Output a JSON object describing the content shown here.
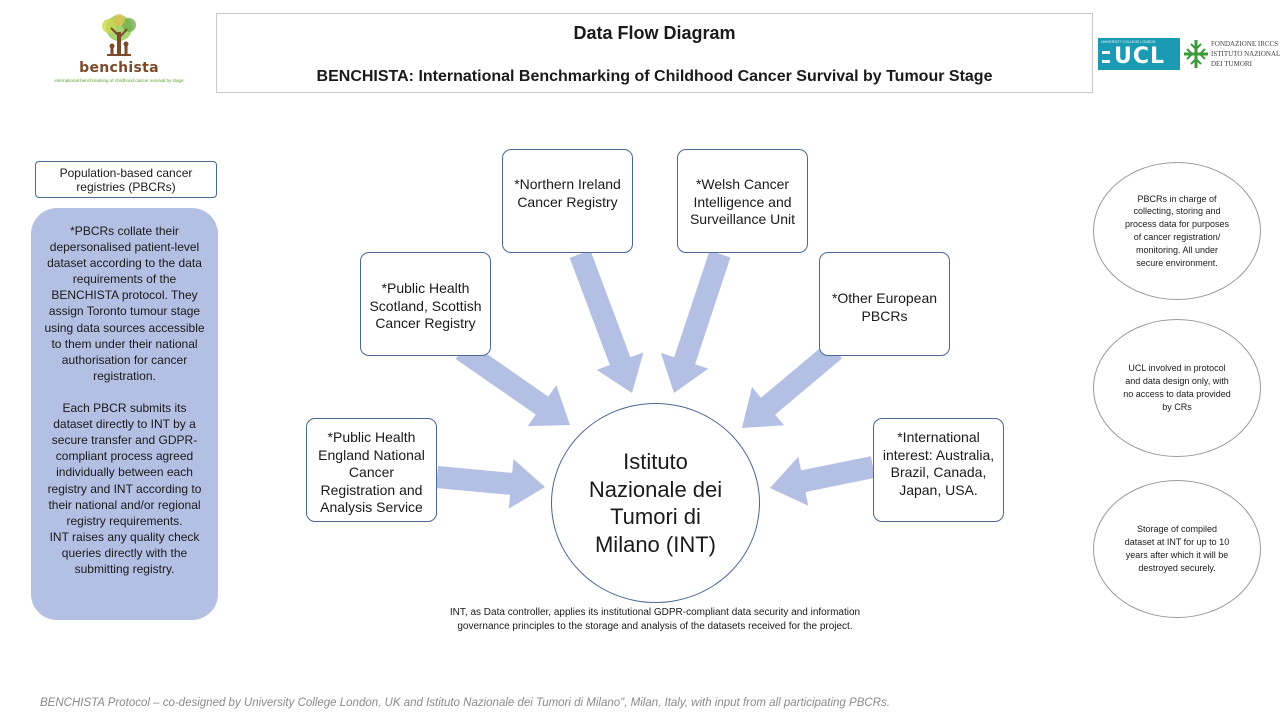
{
  "header": {
    "title": "Data Flow Diagram",
    "subtitle": "BENCHISTA: International Benchmarking of Childhood Cancer Survival by Tumour Stage"
  },
  "logos": {
    "benchista": {
      "wordmark": "benchista",
      "tagline": "international benchmarking of childhood cancer survival by stage"
    },
    "ucl": {
      "wordmark": "UCL",
      "banner": "UNIVERSITY COLLEGE LONDON"
    },
    "int": {
      "lines": [
        "FONDAZIONE IRCCS",
        "ISTITUTO NAZIONALE",
        "DEI TUMORI"
      ]
    }
  },
  "left_panel": {
    "label": "Population-based cancer registries (PBCRs)",
    "description": "*PBCRs collate their depersonalised patient-level dataset according to the data requirements of the BENCHISTA protocol. They assign Toronto tumour stage using data sources accessible to them under their national authorisation for cancer registration.\n\nEach PBCR  submits its dataset directly to INT by a secure transfer and GDPR-compliant process agreed individually between each registry and INT according to their national and/or regional registry requirements.\nINT raises any quality check queries directly with the submitting registry."
  },
  "registries": [
    {
      "id": "ni",
      "label": "*Northern Ireland Cancer Registry"
    },
    {
      "id": "wales",
      "label": "*Welsh Cancer Intelligence and Surveillance Unit"
    },
    {
      "id": "scotland",
      "label": "*Public Health Scotland, Scottish Cancer Registry"
    },
    {
      "id": "europe",
      "label": "*Other European PBCRs"
    },
    {
      "id": "england",
      "label": "*Public Health England National Cancer Registration and Analysis Service"
    },
    {
      "id": "intl",
      "label": "*International interest: Australia, Brazil, Canada, Japan, USA."
    }
  ],
  "center": {
    "label": "Istituto Nazionale dei Tumori di Milano (INT)",
    "note": "INT, as Data controller, applies its institutional GDPR-compliant  data security and information governance principles to the storage and analysis of the datasets received for the project."
  },
  "side_notes": [
    "PBCRs in charge of collecting, storing and process data for purposes of cancer registration/ monitoring. All under secure environment.",
    "UCL involved in protocol and data design only, with no access to data provided by CRs",
    "Storage of compiled dataset at INT  for up to 10 years after which it will be destroyed securely."
  ],
  "footer": "BENCHISTA Protocol – co-designed by University College London, UK and Istituto Nazionale dei Tumori di Milano\", Milan, Italy, with input from all participating PBCRs.",
  "colors": {
    "arrow_fill": "#b3bfe3",
    "box_border": "#4a6796",
    "panel_fill": "#b3bfe3",
    "ucl_teal": "#1a9bb3",
    "int_green": "#3a9a3a",
    "benchista_brown": "#7a4a2a",
    "benchista_green": "#5aa02c"
  }
}
